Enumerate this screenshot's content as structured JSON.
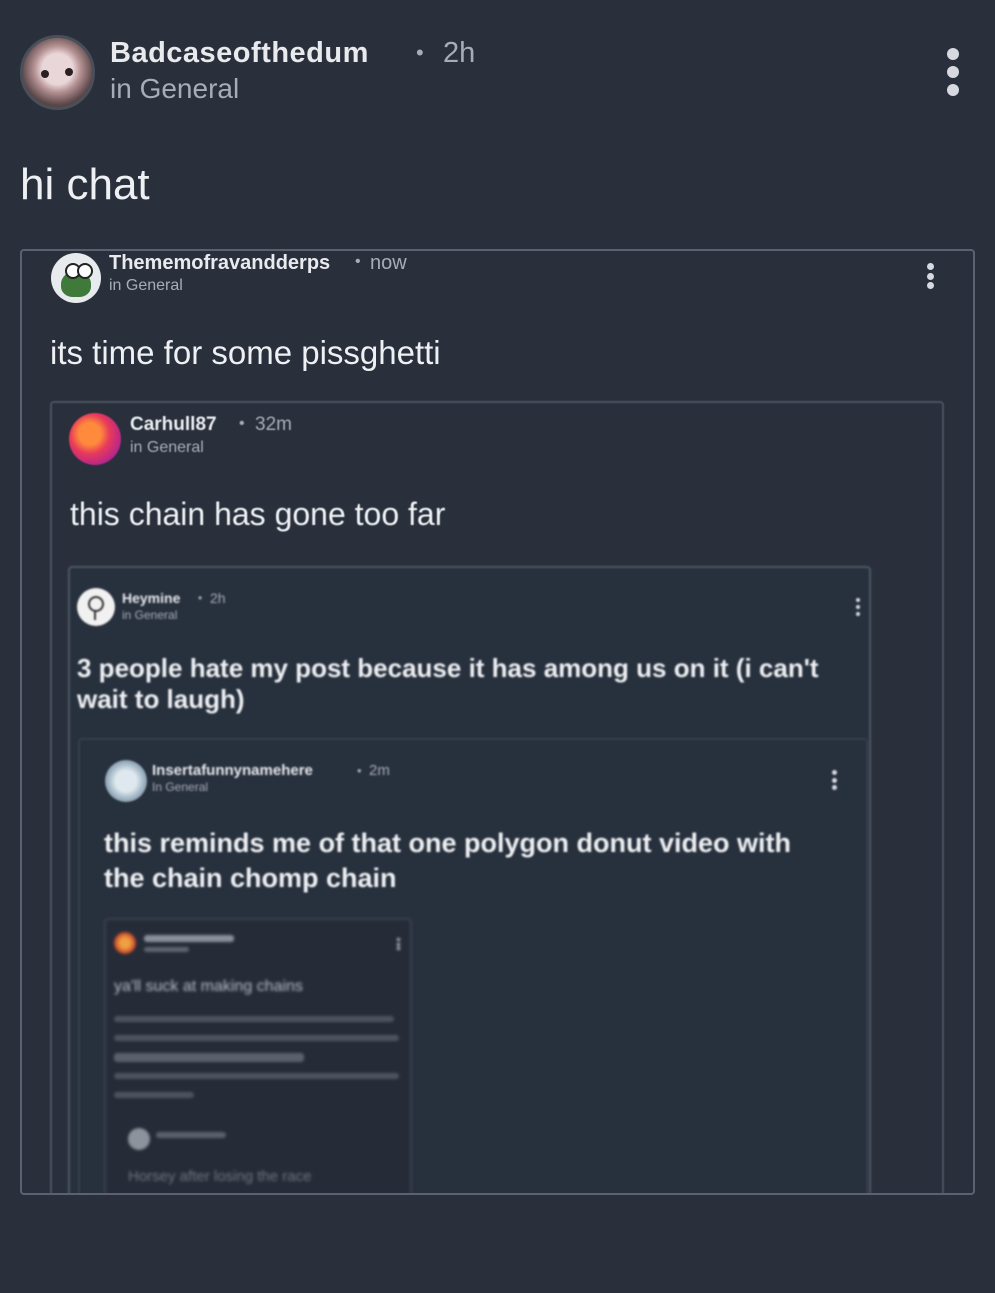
{
  "post": {
    "username": "Badcaseofthedum",
    "time": "2h",
    "sep": "•",
    "community": "in General",
    "text": "hi chat"
  },
  "quote1": {
    "username": "Thememofravandderps",
    "time": "now",
    "sep": "•",
    "community": "in General",
    "text": "its time for some pissghetti"
  },
  "quote2": {
    "username": "Carhull87",
    "time": "32m",
    "sep": "•",
    "community": "in General",
    "text": "this chain has gone too far"
  },
  "quote3": {
    "username": "Heymine",
    "time": "2h",
    "sep": "•",
    "community": "in General",
    "text_line1": "3 people hate my post because it has among us on it (i can't",
    "text_line2": "wait to laugh)"
  },
  "quote4": {
    "username": "Insertafunnynamehere",
    "time": "2m",
    "sep": "•",
    "community": "In General",
    "text_line1": "this reminds me of that one polygon donut video with",
    "text_line2": "the chain chomp chain"
  },
  "quote5": {
    "text": "ya'll suck at making chains",
    "reply": "Horsey after losing the race"
  },
  "colors": {
    "background": "#29303c",
    "border": "#4b5260",
    "text": "#eef0f3",
    "muted": "#a7adb8"
  },
  "icons": {
    "menu": "more-vertical-icon"
  }
}
